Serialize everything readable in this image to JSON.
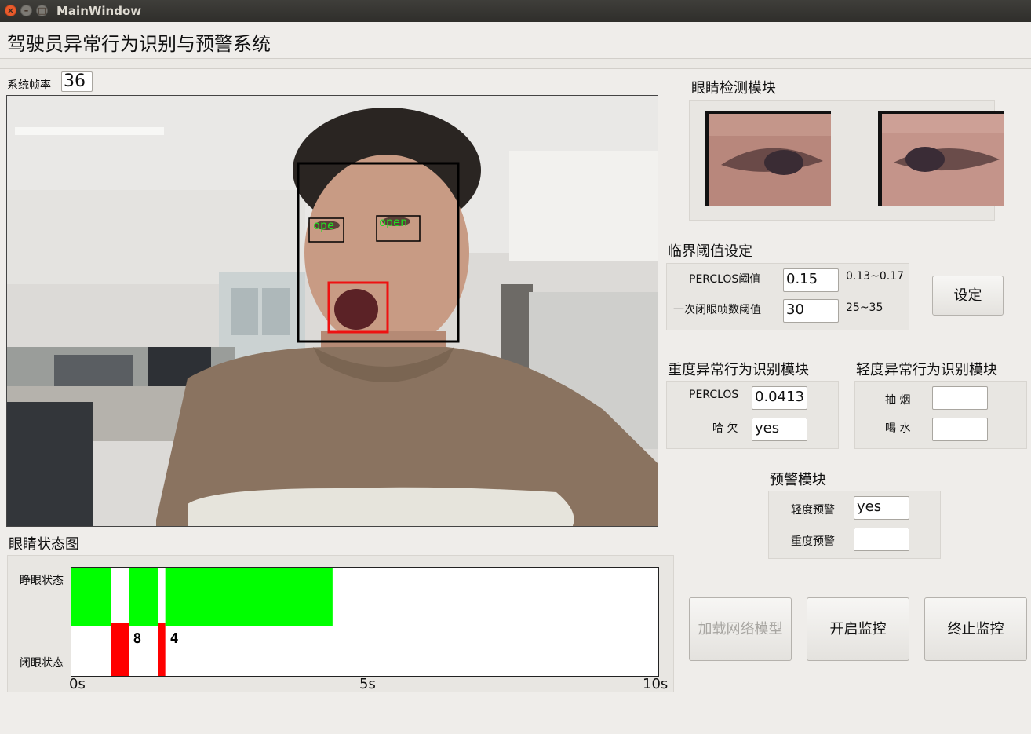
{
  "window": {
    "title": "MainWindow"
  },
  "app": {
    "heading": "驾驶员异常行为识别与预警系统"
  },
  "fps": {
    "label": "系统帧率",
    "value": "36"
  },
  "video": {
    "eye_tags": [
      "ope",
      "open"
    ]
  },
  "eye_module": {
    "title": "眼睛检测模块"
  },
  "threshold": {
    "title": "临界阈值设定",
    "perclos_label": "PERCLOS阈值",
    "perclos_value": "0.15",
    "perclos_range": "0.13~0.17",
    "frames_label": "一次闭眼帧数阈值",
    "frames_value": "30",
    "frames_range": "25~35",
    "set_button": "设定"
  },
  "severe_module": {
    "title": "重度异常行为识别模块",
    "perclos_label": "PERCLOS",
    "perclos_value": "0.0413",
    "yawn_label": "哈 欠",
    "yawn_value": "yes"
  },
  "mild_module": {
    "title": "轻度异常行为识别模块",
    "smoke_label": "抽 烟",
    "smoke_value": "",
    "drink_label": "喝 水",
    "drink_value": ""
  },
  "warning_module": {
    "title": "预警模块",
    "mild_label": "轻度预警",
    "mild_value": "yes",
    "severe_label": "重度预警",
    "severe_value": ""
  },
  "buttons": {
    "load_model": "加载网络模型",
    "start": "开启监控",
    "stop": "终止监控"
  },
  "chart_data": {
    "type": "bar",
    "title": "眼睛状态图",
    "y_categories": [
      "睁眼状态",
      "闭眼状态"
    ],
    "x_ticks": [
      "0s",
      "5s",
      "10s"
    ],
    "xlim": [
      0,
      10
    ],
    "segments": [
      {
        "state": "睁眼状态",
        "start": 0.0,
        "end": 0.68
      },
      {
        "state": "闭眼状态",
        "start": 0.68,
        "end": 0.98
      },
      {
        "state": "睁眼状态",
        "start": 0.98,
        "end": 1.48
      },
      {
        "state": "闭眼状态",
        "start": 1.48,
        "end": 1.6
      },
      {
        "state": "睁眼状态",
        "start": 1.6,
        "end": 4.45
      }
    ],
    "annotations": [
      {
        "text": "8",
        "x": 1.05
      },
      {
        "text": "4",
        "x": 1.68
      }
    ],
    "colors": {
      "open": "#00ff00",
      "closed": "#ff0000"
    }
  }
}
